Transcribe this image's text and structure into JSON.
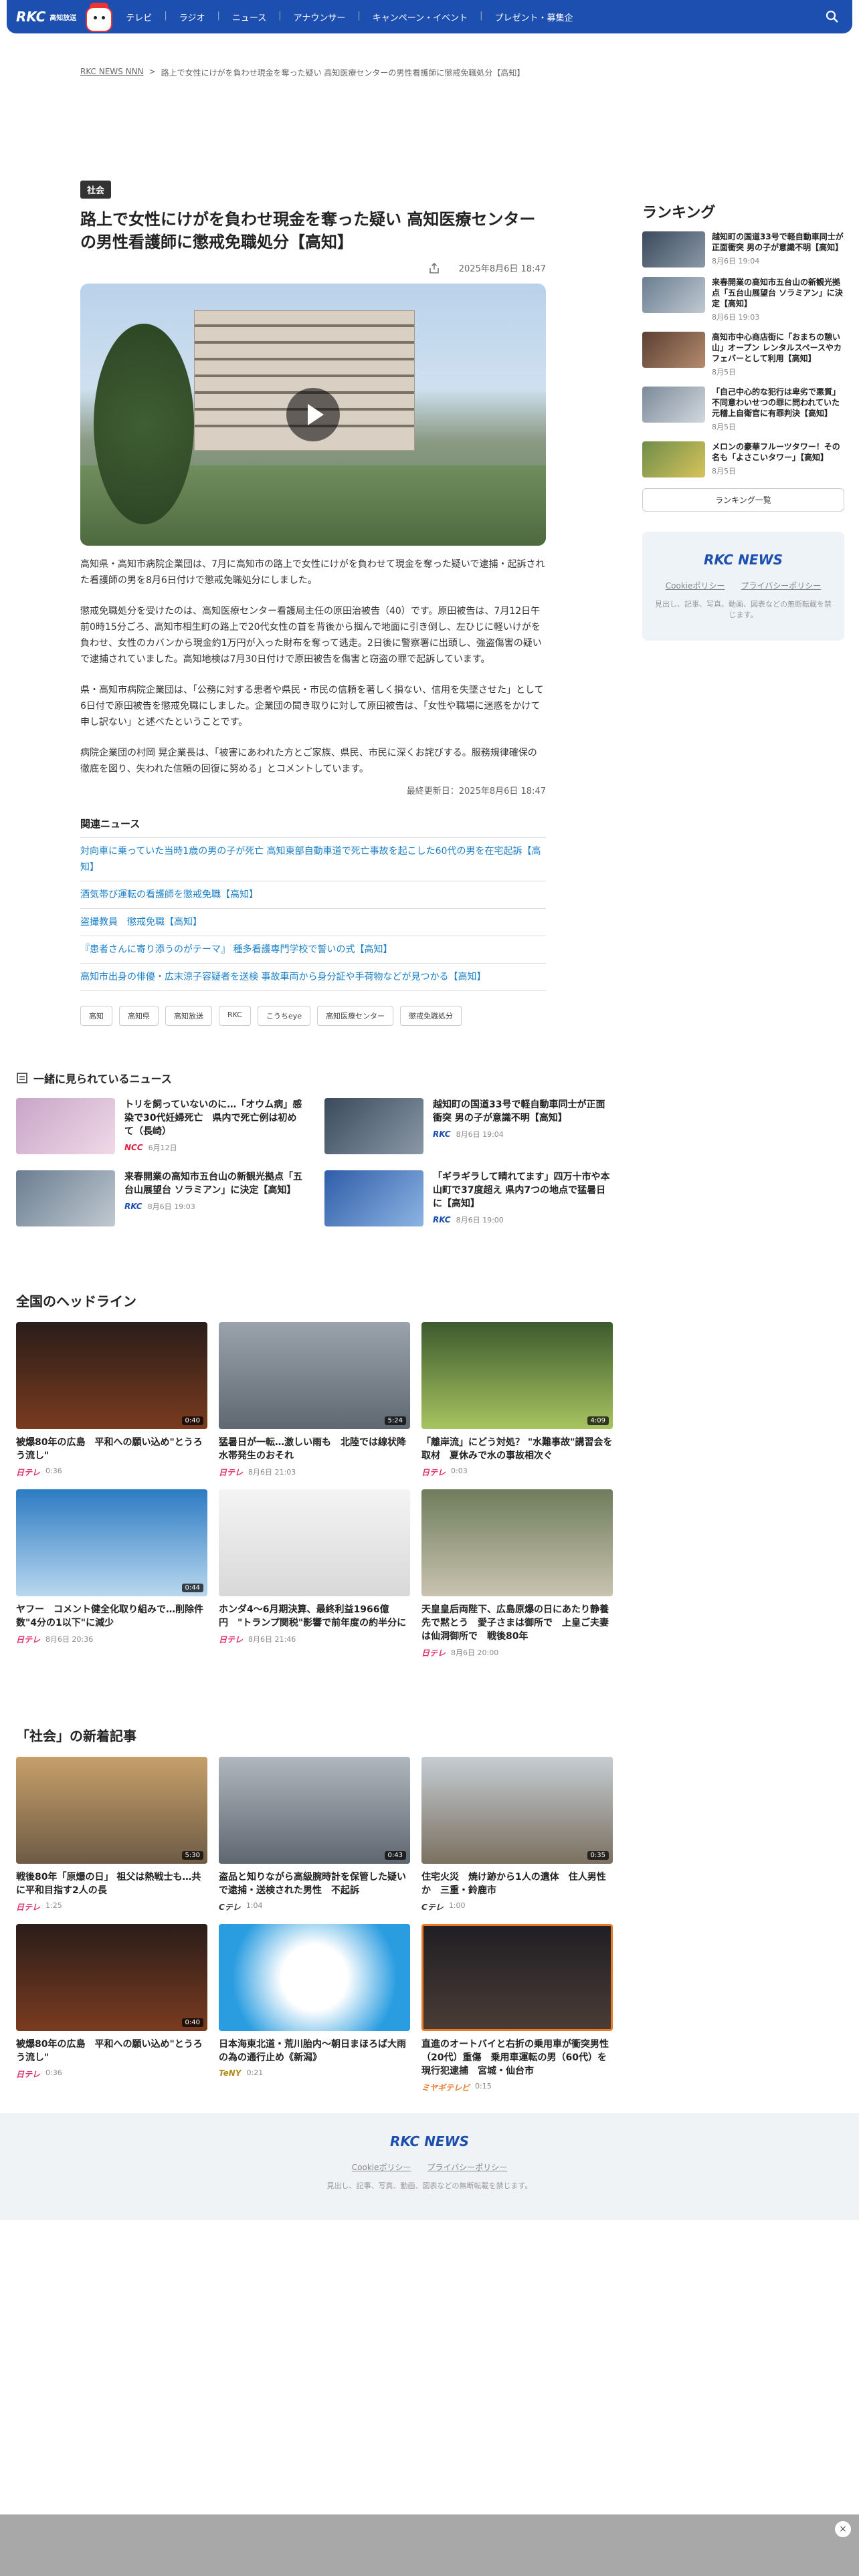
{
  "header": {
    "logo_text": "RKC",
    "logo_sub": "高知放送",
    "nav": [
      "テレビ",
      "ラジオ",
      "ニュース",
      "アナウンサー",
      "キャンペーン・イベント",
      "プレゼント・募集企"
    ]
  },
  "breadcrumb": {
    "home": "RKC NEWS NNN",
    "current": "路上で女性にけがを負わせ現金を奪った疑い 高知医療センターの男性看護師に懲戒免職処分【高知】"
  },
  "article": {
    "category": "社会",
    "title": "路上で女性にけがを負わせ現金を奪った疑い 高知医療センターの男性看護師に懲戒免職処分【高知】",
    "date": "2025年8月6日 18:47",
    "paragraphs": [
      "高知県・高知市病院企業団は、7月に高知市の路上で女性にけがを負わせて現金を奪った疑いで逮捕・起訴された看護師の男を8月6日付けで懲戒免職処分にしました。",
      "懲戒免職処分を受けたのは、高知医療センター看護局主任の原田治被告（40）です。原田被告は、7月12日午前0時15分ごろ、高知市相生町の路上で20代女性の首を背後から掴んで地面に引き倒し、左ひじに軽いけがを負わせ、女性のカバンから現金約1万円が入った財布を奪って逃走。2日後に警察署に出頭し、強盗傷害の疑いで逮捕されていました。高知地検は7月30日付けで原田被告を傷害と窃盗の罪で起訴しています。",
      "県・高知市病院企業団は、「公務に対する患者や県民・市民の信頼を著しく損ない、信用を失墜させた」として6日付で原田被告を懲戒免職にしました。企業団の聞き取りに対して原田被告は、「女性や職場に迷惑をかけて申し訳ない」と述べたということです。",
      "病院企業団の村岡 晃企業長は、「被害にあわれた方とご家族、県民、市民に深くお詫びする。服務規律確保の徹底を図り、失われた信頼の回復に努める」とコメントしています。"
    ],
    "updated": "最終更新日：2025年8月6日 18:47",
    "related_heading": "関連ニュース",
    "related": [
      "対向車に乗っていた当時1歳の男の子が死亡 高知東部自動車道で死亡事故を起こした60代の男を在宅起訴【高知】",
      "酒気帯び運転の看護師を懲戒免職【高知】",
      "盗撮教員　懲戒免職【高知】",
      "『患者さんに寄り添うのがテーマ』 種多看護専門学校で誓いの式【高知】",
      "高知市出身の俳優・広末涼子容疑者を送検 事故車両から身分証や手荷物などが見つかる【高知】"
    ],
    "tags": [
      "高知",
      "高知県",
      "高知放送",
      "RKC",
      "こうちeye",
      "高知医療センター",
      "懲戒免職処分"
    ]
  },
  "ranking": {
    "heading": "ランキング",
    "items": [
      {
        "title": "越知町の国道33号で軽自動車同士が正面衝突 男の子が意識不明【高知】",
        "date": "8月6日 19:04"
      },
      {
        "title": "来春開業の高知市五台山の新観光拠点「五台山展望台 ソラミアン」に決定【高知】",
        "date": "8月6日 19:03"
      },
      {
        "title": "高知市中心商店街に「おまちの憩い山」オープン レンタルスペースやカフェバーとして利用【高知】",
        "date": "8月5日"
      },
      {
        "title": "「自己中心的な犯行は卑劣で悪質」不同意わいせつの罪に問われていた元稽上自衛官に有罪判決【高知】",
        "date": "8月5日"
      },
      {
        "title": "メロンの豪華フルーツタワー！その名も「よさこいタワー」【高知】",
        "date": "8月5日"
      }
    ],
    "button": "ランキング一覧"
  },
  "brand": {
    "logo": "RKC NEWS",
    "cookie": "Cookieポリシー",
    "privacy": "プライバシーポリシー",
    "note": "見出し、記事、写真、動画、図表などの無断転載を禁じます。"
  },
  "together": {
    "heading": "一緒に見られているニュース",
    "items": [
      {
        "title": "トリを飼っていないのに…「オウム病」感染で30代妊婦死亡　県内で死亡例は初めて（長崎）",
        "source": "NCC",
        "date": "6月12日"
      },
      {
        "title": "越知町の国道33号で軽自動車同士が正面衝突 男の子が意識不明【高知】",
        "source": "RKC",
        "date": "8月6日 19:04"
      },
      {
        "title": "来春開業の高知市五台山の新観光拠点「五台山展望台 ソラミアン」に決定【高知】",
        "source": "RKC",
        "date": "8月6日 19:03"
      },
      {
        "title": "「ギラギラして晴れてます」四万十市や本山町で37度超え 県内7つの地点で猛暑日に【高知】",
        "source": "RKC",
        "date": "8月6日 19:00"
      }
    ]
  },
  "headlines": {
    "heading": "全国のヘッドライン",
    "items": [
      {
        "title": "被爆80年の広島　平和への願い込め\"とうろう流し\"",
        "source": "日テレ",
        "date": "0:36",
        "dur": "0:40"
      },
      {
        "title": "猛暑日が一転…激しい雨も　北陸では線状降水帯発生のおそれ",
        "source": "日テレ",
        "date": "8月6日 21:03",
        "dur": "5:24"
      },
      {
        "title": "「離岸流」にどう対処？ \"水難事故\"講習会を取材　夏休みで水の事故相次ぐ",
        "source": "日テレ",
        "date": "0:03",
        "dur": "4:09"
      },
      {
        "title": "ヤフー　コメント健全化取り組みで…削除件数\"4分の1以下\"に減少",
        "source": "日テレ",
        "date": "8月6日 20:36",
        "dur": "0:44"
      },
      {
        "title": "ホンダ4～6月期決算、最終利益1966億円　\"トランプ関税\"影響で前年度の約半分に",
        "source": "日テレ",
        "date": "8月6日 21:46",
        "dur": ""
      },
      {
        "title": "天皇皇后両陛下、広島原爆の日にあたり静養先で黙とう　愛子さまは御所で　上皇ご夫妻は仙洞御所で　戦後80年",
        "source": "日テレ",
        "date": "8月6日 20:00",
        "dur": ""
      }
    ]
  },
  "social": {
    "heading": "「社会」の新着記事",
    "items": [
      {
        "title": "戦後80年「原爆の日」 祖父は熱戦士も…共に平和目指す2人の長",
        "source": "日テレ",
        "date": "1:25",
        "dur": "5:30"
      },
      {
        "title": "盗品と知りながら高級腕時計を保管した疑いで逮捕・送検された男性　不起訴",
        "source": "Cテレ",
        "date": "1:04",
        "dur": "0:43"
      },
      {
        "title": "住宅火災　焼け跡から1人の遺体　住人男性か　三重・鈴鹿市",
        "source": "Cテレ",
        "date": "1:00",
        "dur": "0:35"
      },
      {
        "title": "被爆80年の広島　平和への願い込め\"とうろう流し\"",
        "source": "日テレ",
        "date": "0:36",
        "dur": "0:40"
      },
      {
        "title": "日本海東北道・荒川胎内～朝日まほろば大雨の為の通行止め《新潟》",
        "source": "TeNY",
        "date": "0:21",
        "dur": ""
      },
      {
        "title": "直進のオートバイと右折の乗用車が衝突男性（20代）重傷　乗用車運転の男（60代）を現行犯逮捕　宮城・仙台市",
        "source": "ミヤギテレビ",
        "date": "0:15",
        "dur": ""
      }
    ]
  },
  "footer": {
    "logo": "RKC NEWS",
    "cookie": "Cookieポリシー",
    "privacy": "プライバシーポリシー",
    "note": "見出し、記事、写真、動画、図表などの無断転載を禁じます。"
  },
  "colors": {
    "brand": "#1c4fb0",
    "link": "#1a7fc6"
  }
}
